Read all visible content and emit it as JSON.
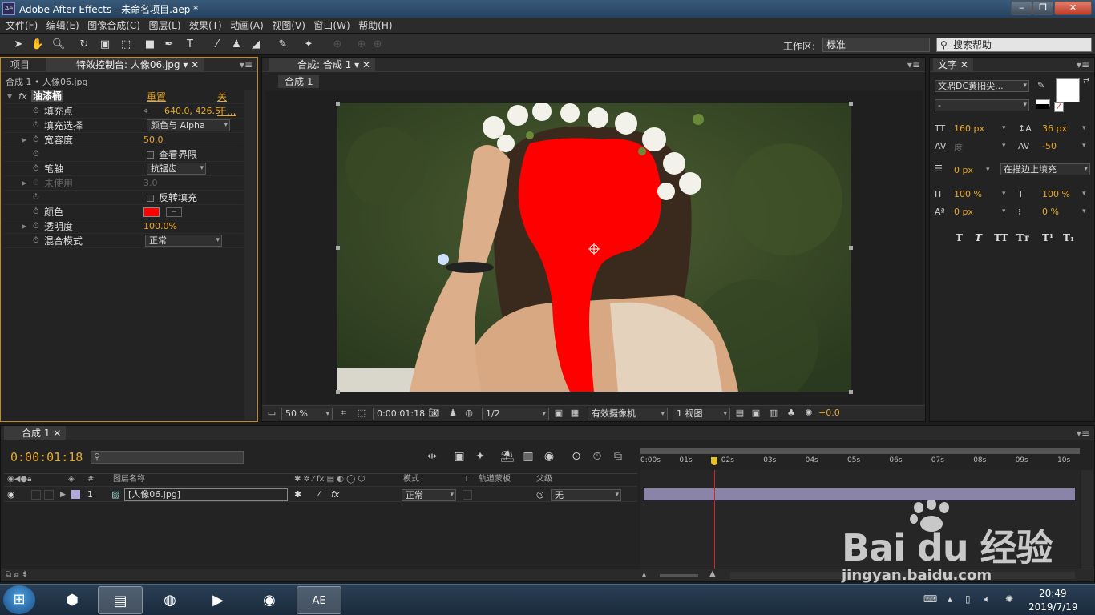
{
  "window": {
    "title": "Adobe After Effects - 未命名项目.aep *",
    "icon": "Ae"
  },
  "menu": [
    "文件(F)",
    "编辑(E)",
    "图像合成(C)",
    "图层(L)",
    "效果(T)",
    "动画(A)",
    "视图(V)",
    "窗口(W)",
    "帮助(H)"
  ],
  "toolbar": {
    "workspace_label": "工作区:",
    "workspace_value": "标准",
    "help_placeholder": "搜索帮助"
  },
  "effects_panel": {
    "tab_project": "项目",
    "tab_effects": "特效控制台: 人像06.jpg",
    "subtitle": "合成 1 • 人像06.jpg",
    "effect_name": "油漆桶",
    "fx": "fx",
    "reset": "重置",
    "about": "关于...",
    "rows": {
      "fill_point": {
        "label": "填充点",
        "value": "640.0, 426.5"
      },
      "fill_selector": {
        "label": "填充选择",
        "value": "颜色与 Alpha"
      },
      "tolerance": {
        "label": "宽容度",
        "value": "50.0"
      },
      "view_threshold": {
        "label": "查看界限"
      },
      "stroke": {
        "label": "笔触",
        "value": "抗锯齿"
      },
      "unused": {
        "label": "未使用",
        "value": "3.0"
      },
      "invert_fill": {
        "label": "反转填充"
      },
      "color": {
        "label": "颜色",
        "swatch": "#ff0000"
      },
      "opacity": {
        "label": "透明度",
        "value": "100.0%"
      },
      "blend_mode": {
        "label": "混合模式",
        "value": "正常"
      }
    }
  },
  "comp_panel": {
    "tab": "合成: 合成 1",
    "breadcrumb": "合成 1",
    "bottom": {
      "zoom": "50 %",
      "timecode": "0:00:01:18",
      "resolution": "1/2",
      "camera": "有效摄像机",
      "views": "1 视图",
      "exposure": "+0.0"
    }
  },
  "char_panel": {
    "tab": "文字",
    "font": "文鼎DC黄阳尖...",
    "style": "-",
    "size": "160 px",
    "leading": "36 px",
    "kerning": "度",
    "tracking": "-50",
    "stroke_width": "0 px",
    "stroke_mode": "在描边上填充",
    "vscale": "100 %",
    "hscale": "100 %",
    "baseline": "0 px",
    "tsume": "0 %",
    "style_buttons": [
      "T",
      "T",
      "TT",
      "Tт",
      "T¹",
      "T₁"
    ]
  },
  "timeline": {
    "tab": "合成 1",
    "timecode": "0:00:01:18",
    "columns": {
      "name": "图层名称",
      "mode": "模式",
      "t": "T",
      "track_matte": "轨道蒙板",
      "parent": "父级"
    },
    "layer": {
      "index": "1",
      "name": "[人像06.jpg]",
      "mode": "正常",
      "parent": "无"
    },
    "ruler": [
      "0:00s",
      "01s",
      "02s",
      "03s",
      "04s",
      "05s",
      "06s",
      "07s",
      "08s",
      "09s",
      "10s"
    ],
    "playhead_seconds": 1.72,
    "duration_seconds": 10
  },
  "watermark": {
    "brand": "Bai du 经验",
    "url": "jingyan.baidu.com"
  },
  "taskbar": {
    "time": "20:49",
    "date": "2019/7/19",
    "active_app": "AE"
  }
}
